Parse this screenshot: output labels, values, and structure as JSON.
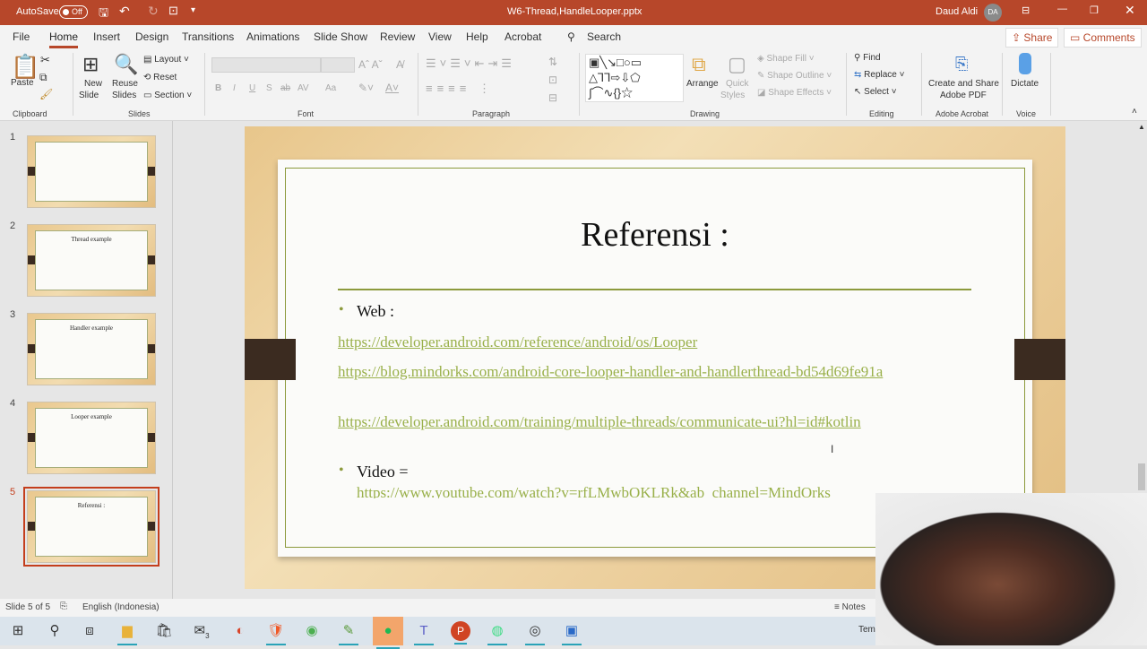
{
  "titlebar": {
    "autosave": "AutoSave",
    "toggle": "Off",
    "filename": "W6-Thread,HandleLooper.pptx",
    "user": "Daud Aldi",
    "initials": "DA"
  },
  "tabs": [
    "File",
    "Home",
    "Insert",
    "Design",
    "Transitions",
    "Animations",
    "Slide Show",
    "Review",
    "View",
    "Help",
    "Acrobat"
  ],
  "search": "Search",
  "share": "Share",
  "comments": "Comments",
  "ribbon": {
    "clipboard": {
      "paste": "Paste",
      "label": "Clipboard"
    },
    "slides": {
      "new": "New",
      "new2": "Slide",
      "reuse": "Reuse",
      "reuse2": "Slides",
      "layout": "Layout",
      "reset": "Reset",
      "section": "Section",
      "label": "Slides"
    },
    "font": {
      "label": "Font",
      "bold": "B",
      "italic": "I",
      "underline": "U",
      "shadow": "S",
      "strike": "ab",
      "spacing": "AV",
      "case": "Aa"
    },
    "paragraph": {
      "label": "Paragraph"
    },
    "drawing": {
      "arrange": "Arrange",
      "quick": "Quick",
      "quick2": "Styles",
      "fill": "Shape Fill",
      "outline": "Shape Outline",
      "effects": "Shape Effects",
      "label": "Drawing"
    },
    "editing": {
      "find": "Find",
      "replace": "Replace",
      "select": "Select",
      "label": "Editing"
    },
    "acrobat": {
      "create": "Create and Share",
      "create2": "Adobe PDF",
      "label": "Adobe Acrobat"
    },
    "voice": {
      "dictate": "Dictate",
      "label": "Voice"
    }
  },
  "thumbnails": [
    {
      "num": "1",
      "title": ""
    },
    {
      "num": "2",
      "title": "Thread example"
    },
    {
      "num": "3",
      "title": "Handler example"
    },
    {
      "num": "4",
      "title": "Looper example"
    },
    {
      "num": "5",
      "title": "Referensi :"
    }
  ],
  "slide": {
    "title": "Referensi :",
    "web_label": "Web :",
    "links": [
      "https://developer.android.com/reference/android/os/Looper",
      "https://blog.mindorks.com/android-core-looper-handler-and-handlerthread-bd54d69fe91a",
      "https://developer.android.com/training/multiple-threads/communicate-ui?hl=id#kotlin"
    ],
    "video_label": "Video =",
    "video_link": "https://www.youtube.com/watch?v=rfLMwbOKLRk&ab_channel=MindOrks"
  },
  "status": {
    "slide": "Slide 5 of 5",
    "language": "English (Indonesia)",
    "notes": "Notes"
  },
  "taskbar": {
    "mail_badge": "3",
    "tray": "Tem"
  },
  "colors": {
    "accent": "#b7472a",
    "link": "#99b04a",
    "frame": "#8c9a3c"
  }
}
